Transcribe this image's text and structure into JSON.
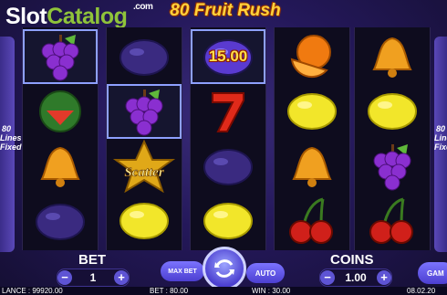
{
  "header": {
    "logo_slot": "Slot",
    "logo_catalog": "Catalog",
    "logo_com": ".com",
    "game_title": "80 Fruit Rush"
  },
  "side": {
    "left_text": "80 Lines Fixed",
    "right_text": "80 Lines Fixed"
  },
  "reels": [
    [
      "grapes",
      "watermelon",
      "bell",
      "plum"
    ],
    [
      "plum",
      "grapes",
      "scatter",
      "lemon"
    ],
    [
      "plum",
      "seven",
      "plum",
      "lemon"
    ],
    [
      "orange",
      "lemon",
      "bell",
      "cherries"
    ],
    [
      "bell",
      "lemon",
      "grapes",
      "cherries"
    ]
  ],
  "win_amount": "15.00",
  "scatter_label": "Scatter",
  "controls": {
    "bet_label": "BET",
    "bet_value": "1",
    "coins_label": "COINS",
    "coins_value": "1.00",
    "max_bet_label": "MAX BET",
    "auto_label": "AUTO",
    "game_label": "GAM",
    "minus": "−",
    "plus": "+"
  },
  "status_bar": {
    "balance": "LANCE : 99920.00",
    "bet": "BET : 80.00",
    "win": "WIN : 30.00",
    "time": "08.02.20"
  },
  "colors": {
    "accent": "#5e54d4",
    "title": "#ffd23c",
    "logo_green": "#8fc33a",
    "win_text": "#ffe04a"
  }
}
